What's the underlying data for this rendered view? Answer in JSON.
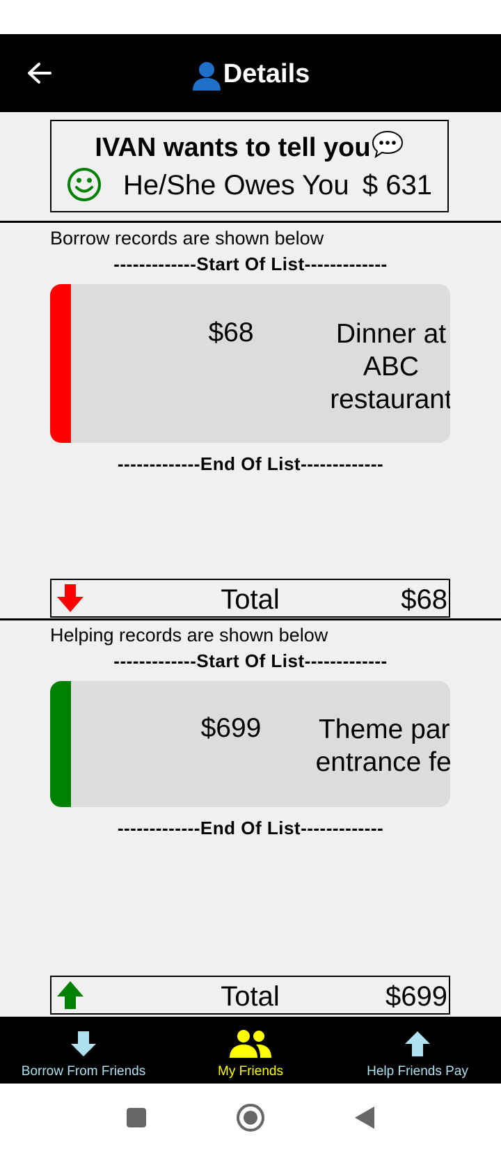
{
  "header": {
    "title": "Details"
  },
  "summary": {
    "headline": "IVAN wants to tell you",
    "status": "He/She Owes You",
    "amount": "$ 631"
  },
  "borrow": {
    "section_label": "Borrow records are shown below",
    "start_label": "-------------Start Of List-------------",
    "end_label": "-------------End Of List-------------",
    "records": [
      {
        "amount": "$68",
        "description": "Dinner at ABC restaurant"
      }
    ],
    "total_label": "Total",
    "total_amount": "$68",
    "accent": "#ff0000"
  },
  "helping": {
    "section_label": "Helping records are shown below",
    "start_label": "-------------Start Of List-------------",
    "end_label": "-------------End Of List-------------",
    "records": [
      {
        "amount": "$699",
        "description": "Theme park entrance fee"
      }
    ],
    "total_label": "Total",
    "total_amount": "$699",
    "accent": "#008000"
  },
  "bottom_nav": {
    "items": [
      {
        "label": "Borrow From Friends",
        "icon": "arrow-down-icon",
        "color": "#aee0ef"
      },
      {
        "label": "My Friends",
        "icon": "friends-icon",
        "color": "#ffff00",
        "active": true
      },
      {
        "label": "Help Friends Pay",
        "icon": "arrow-up-icon",
        "color": "#aee0ef"
      }
    ]
  },
  "system_nav": {
    "icons": [
      "recents-icon",
      "home-icon",
      "back-triangle-icon"
    ]
  }
}
